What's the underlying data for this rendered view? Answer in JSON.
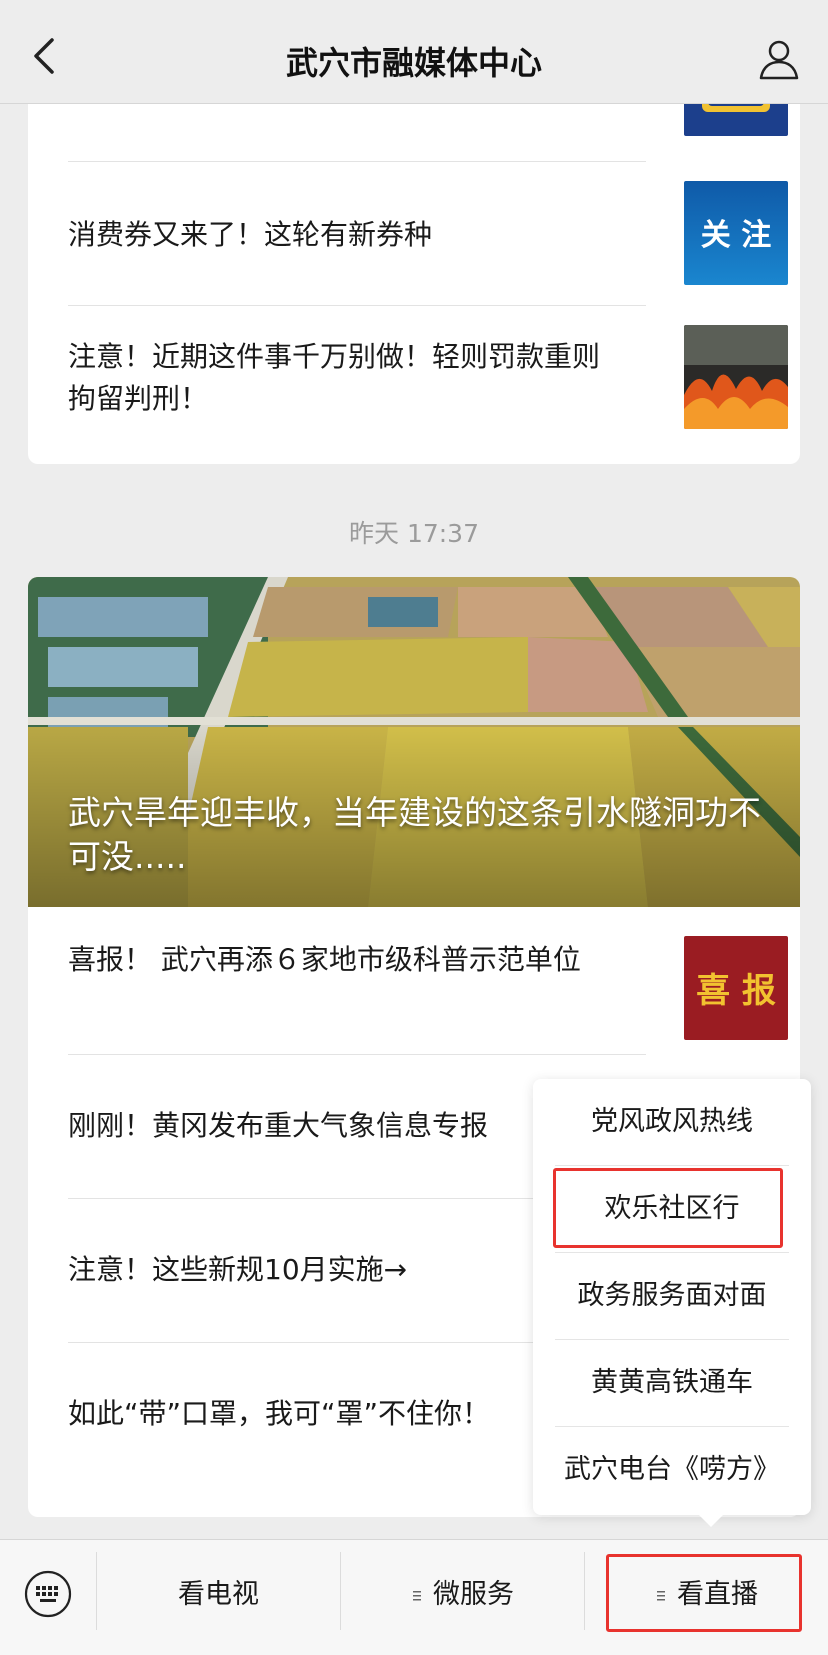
{
  "header": {
    "title": "武穴市融媒体中心"
  },
  "feed": {
    "card1_items": [
      {
        "title": "消费券又来了！这轮有新券种",
        "thumb_text": "关 注"
      },
      {
        "title": "注意！近期这件事千万别做！轻则罚款重则拘留判刑！"
      }
    ],
    "timestamp": "昨天 17:37",
    "featured": {
      "title": "武穴旱年迎丰收，当年建设的这条引水隧洞功不可没....."
    },
    "card2_items": [
      {
        "title": "喜报！ 武穴再添６家地市级科普示范单位",
        "thumb_text": "喜 报"
      },
      {
        "title": "刚刚！黄冈发布重大气象信息专报"
      },
      {
        "title": "注意！这些新规10月实施→"
      },
      {
        "title": "如此“带”口罩，我可“罩”不住你！"
      }
    ]
  },
  "popup_menu": {
    "items": [
      "党风政风热线",
      "欢乐社区行",
      "政务服务面对面",
      "黄黄高铁通车",
      "武穴电台《唠方》"
    ]
  },
  "bottom_menu": {
    "tv": "看电视",
    "services": "微服务",
    "live": "看直播"
  },
  "colors": {
    "highlight": "#e8332e",
    "background": "#ededed"
  }
}
